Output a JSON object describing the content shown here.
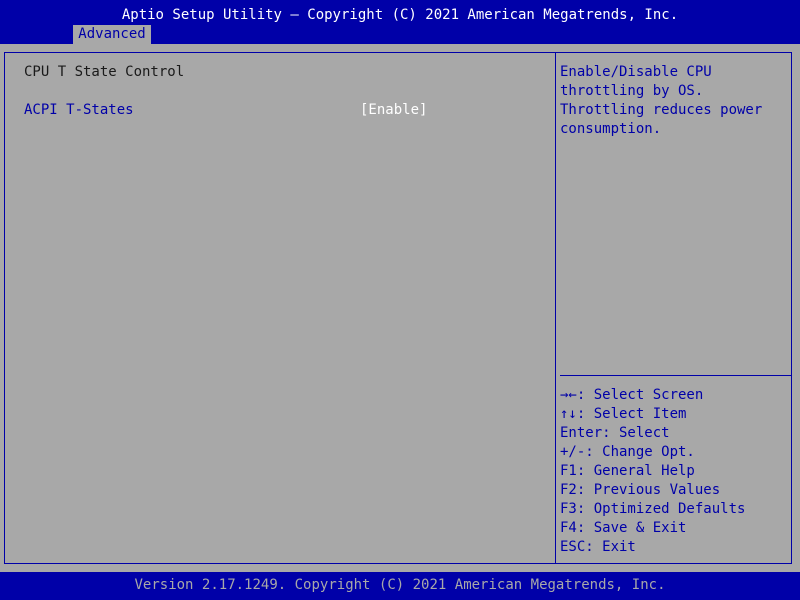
{
  "header": {
    "title": "Aptio Setup Utility – Copyright (C) 2021 American Megatrends, Inc.",
    "active_tab": "Advanced"
  },
  "main": {
    "section_title": "CPU T State Control",
    "settings": [
      {
        "label": "ACPI T-States",
        "value": "[Enable]"
      }
    ]
  },
  "help": {
    "text": "Enable/Disable CPU\nthrottling by OS.\nThrottling reduces power\nconsumption.",
    "keys": [
      "→←: Select Screen",
      "↑↓: Select Item",
      "Enter: Select",
      "+/-: Change Opt.",
      "F1: General Help",
      "F2: Previous Values",
      "F3: Optimized Defaults",
      "F4: Save & Exit",
      "ESC: Exit"
    ]
  },
  "footer": {
    "text": "Version 2.17.1249. Copyright (C) 2021 American Megatrends, Inc."
  },
  "colors": {
    "bios_blue": "#0000a8",
    "panel_gray": "#a8a8a8",
    "highlight_white": "#ffffff"
  }
}
